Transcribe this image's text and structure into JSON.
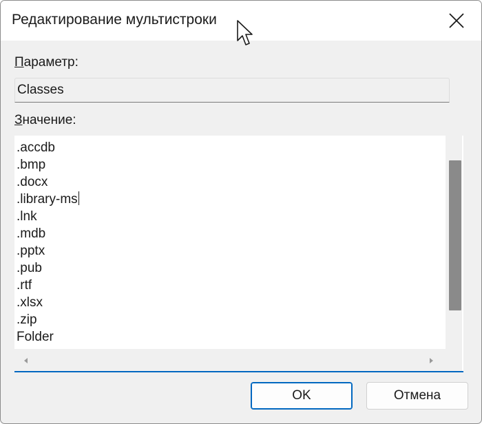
{
  "window": {
    "title": "Редактирование мультистроки",
    "close_icon": "close-icon"
  },
  "param": {
    "label_accel": "П",
    "label_rest": "араметр:",
    "value": "Classes"
  },
  "value_section": {
    "label_accel": "З",
    "label_rest": "начение:",
    "lines": [
      ".accdb",
      ".bmp",
      ".docx",
      ".library-ms",
      ".lnk",
      ".mdb",
      ".pptx",
      ".pub",
      ".rtf",
      ".xlsx",
      ".zip",
      "Folder"
    ],
    "caret_line_index": 3
  },
  "buttons": {
    "ok": "OK",
    "cancel": "Отмена"
  },
  "colors": {
    "accent": "#0067c0",
    "scroll_thumb": "#8a8a8a",
    "dialog_bg": "#f0f0f0"
  }
}
